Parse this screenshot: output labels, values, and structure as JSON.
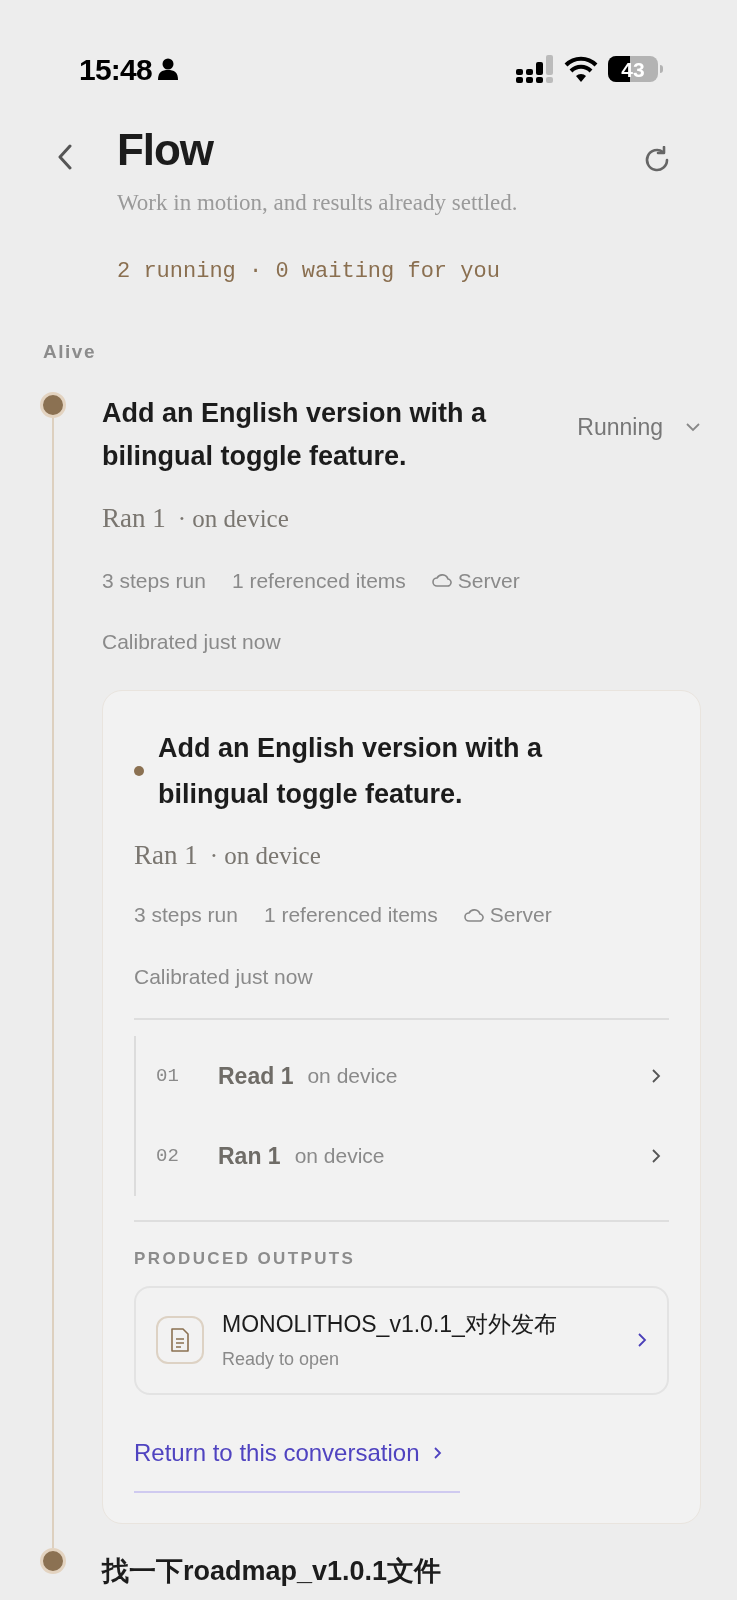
{
  "status_bar": {
    "time": "15:48",
    "battery": "43"
  },
  "header": {
    "title": "Flow",
    "subtitle": "Work in motion, and results already settled.",
    "summary": "2 running · 0 waiting for you"
  },
  "section": {
    "label": "Alive"
  },
  "items": [
    {
      "title": "Add an English version with a bilingual toggle feature.",
      "status": "Running",
      "expanded": true,
      "run_main": "Ran 1",
      "run_detail": "· on device",
      "meta": [
        {
          "kind": "text",
          "text": "3 steps run"
        },
        {
          "kind": "text",
          "text": "1 referenced items"
        },
        {
          "kind": "location",
          "text": "Server"
        }
      ],
      "calibrated": "Calibrated just now",
      "detail": {
        "title": "Add an English version with a bilingual toggle feature.",
        "run_main": "Ran 1",
        "run_detail": "· on device",
        "meta": [
          {
            "kind": "text",
            "text": "3 steps run"
          },
          {
            "kind": "text",
            "text": "1 referenced items"
          },
          {
            "kind": "location",
            "text": "Server"
          }
        ],
        "calibrated": "Calibrated just now",
        "steps": [
          {
            "number": "01",
            "action": "Read 1",
            "where": "on device"
          },
          {
            "number": "02",
            "action": "Ran 1",
            "where": "on device"
          }
        ],
        "outputs_label": "PRODUCED OUTPUTS",
        "outputs": [
          {
            "name": "MONOLITHOS_v1.0.1_对外发布",
            "state": "Ready to open"
          }
        ],
        "return_link": "Return to this conversation"
      }
    },
    {
      "title": "找一下roadmap_v1.0.1文件",
      "expanded": false
    }
  ]
}
